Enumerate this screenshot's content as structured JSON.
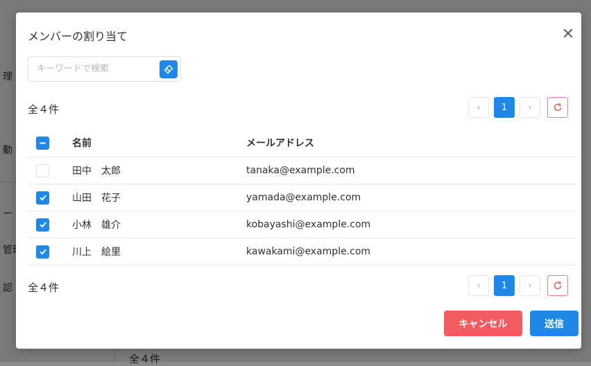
{
  "background": {
    "fragments": [
      "理",
      "動",
      "ー",
      "管理",
      "認",
      "全４件"
    ]
  },
  "dialog": {
    "title": "メンバーの割り当て",
    "close_glyph": "✕",
    "search": {
      "placeholder": "キーワードで検索",
      "value": ""
    },
    "count_top": "全４件",
    "count_bottom": "全４件",
    "pagination": {
      "prev": "‹",
      "current": "1",
      "next": "›"
    },
    "table": {
      "headers": {
        "name": "名前",
        "email": "メールアドレス"
      },
      "select_all_state": "indeterminate",
      "rows": [
        {
          "name": "田中　太郎",
          "email": "tanaka@example.com",
          "checked": false
        },
        {
          "name": "山田　花子",
          "email": "yamada@example.com",
          "checked": true
        },
        {
          "name": "小林　雄介",
          "email": "kobayashi@example.com",
          "checked": true
        },
        {
          "name": "川上　絵里",
          "email": "kawakami@example.com",
          "checked": true
        }
      ]
    },
    "buttons": {
      "cancel": "キャンセル",
      "submit": "送信"
    },
    "colors": {
      "primary": "#1f87e5",
      "danger": "#f25c60"
    }
  }
}
